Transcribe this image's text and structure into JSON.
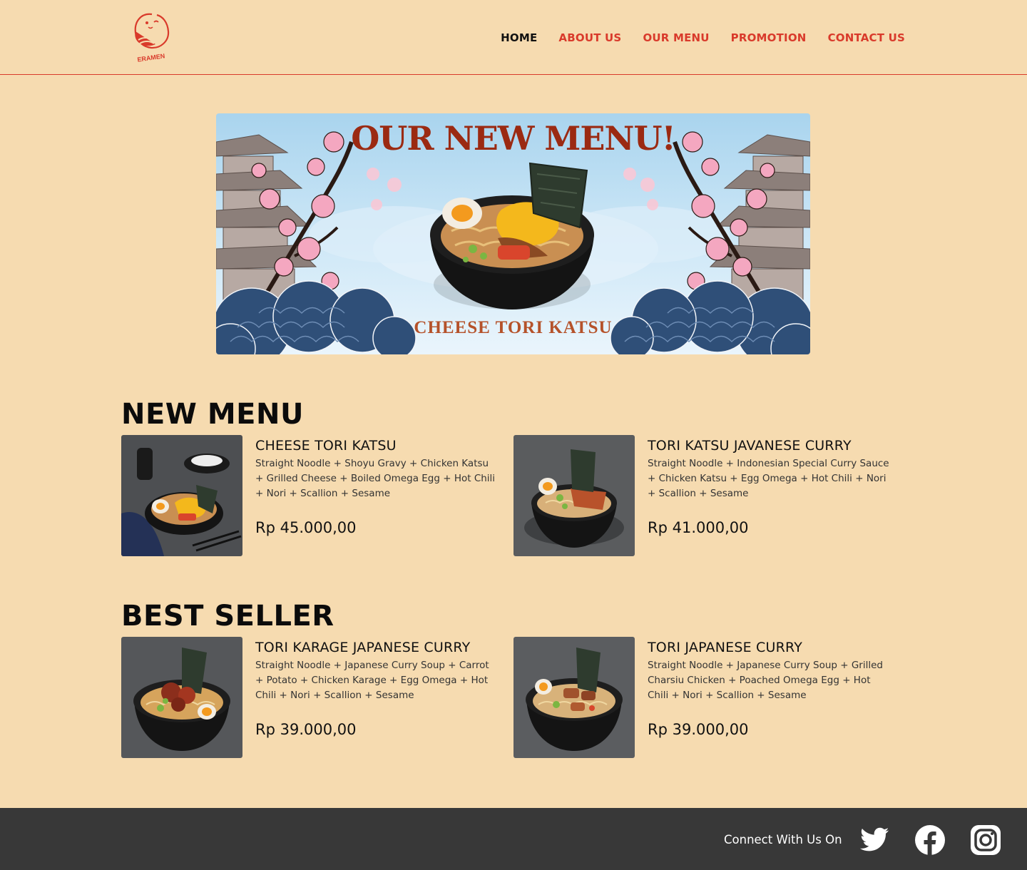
{
  "brand": {
    "logo_text": "ERAMEN"
  },
  "nav": [
    {
      "label": "HOME",
      "active": true
    },
    {
      "label": "ABOUT US",
      "active": false
    },
    {
      "label": "OUR MENU",
      "active": false
    },
    {
      "label": "PROMOTION",
      "active": false
    },
    {
      "label": "CONTACT US",
      "active": false
    }
  ],
  "banner": {
    "title": "OUR NEW MENU!",
    "subtitle": "CHEESE TORI KATSU"
  },
  "sections": {
    "new_menu": {
      "title": "NEW MENU",
      "items": [
        {
          "name": "CHEESE TORI KATSU",
          "description": "Straight Noodle + Shoyu Gravy + Chicken Katsu + Grilled Cheese + Boiled Omega Egg + Hot Chili + Nori + Scallion + Sesame",
          "price": "Rp 45.000,00"
        },
        {
          "name": "TORI KATSU JAVANESE CURRY",
          "description": "Straight Noodle + Indonesian Special Curry Sauce + Chicken Katsu + Egg Omega + Hot Chili + Nori + Scallion + Sesame",
          "price": "Rp 41.000,00"
        }
      ]
    },
    "best_seller": {
      "title": "BEST SELLER",
      "items": [
        {
          "name": "TORI KARAGE JAPANESE CURRY",
          "description": "Straight Noodle + Japanese Curry Soup + Carrot + Potato + Chicken Karage + Egg Omega + Hot Chili + Nori + Scallion + Sesame",
          "price": "Rp 39.000,00"
        },
        {
          "name": "TORI JAPANESE CURRY",
          "description": "Straight Noodle + Japanese Curry Soup + Grilled Charsiu Chicken + Poached Omega Egg + Hot Chili + Nori + Scallion + Sesame",
          "price": "Rp 39.000,00"
        }
      ]
    }
  },
  "footer": {
    "connect_label": "Connect With Us On",
    "social_icons": [
      "twitter-icon",
      "facebook-icon",
      "instagram-icon"
    ]
  },
  "colors": {
    "background": "#F6DBB0",
    "accent": "#D93A2B",
    "footer": "#383838",
    "banner_title": "#9B2A12"
  }
}
